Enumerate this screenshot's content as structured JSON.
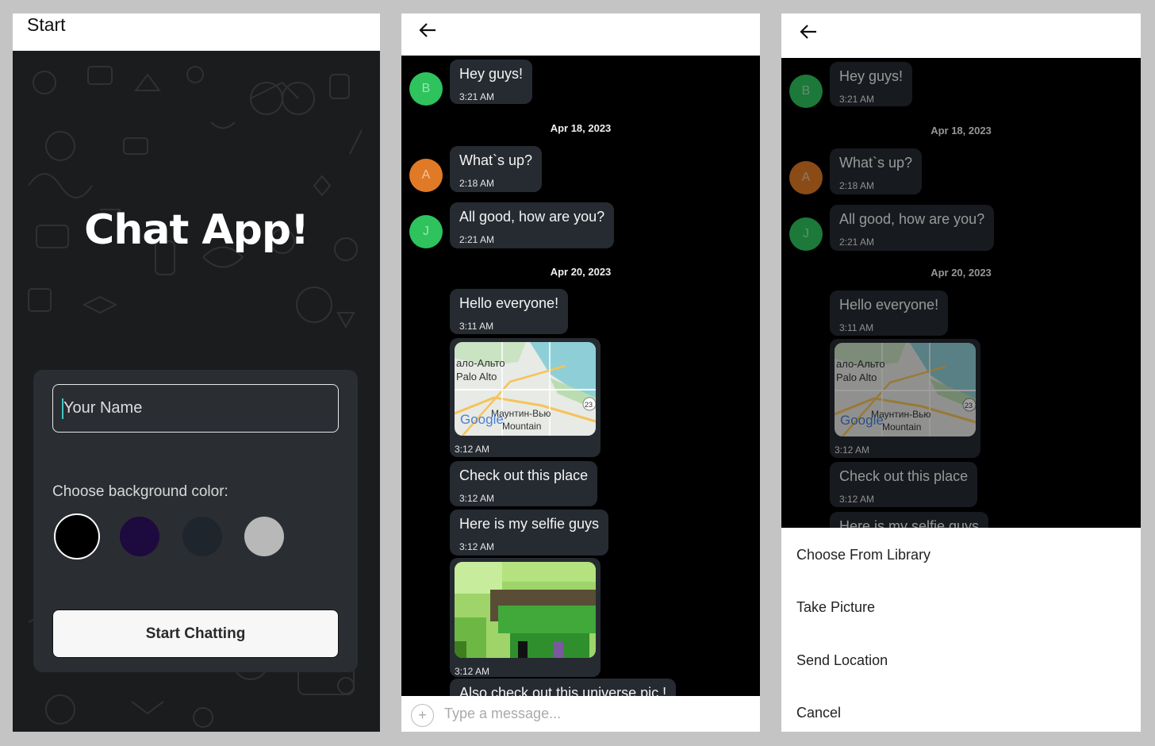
{
  "start_screen": {
    "header_title": "Start",
    "app_title": "Chat App!",
    "name_placeholder": "Your Name",
    "bg_label": "Choose background color:",
    "colors": [
      "#000000",
      "#1d0a3e",
      "#1f252d",
      "#b8b8b8"
    ],
    "selected_color": "#000000",
    "start_button": "Start Chatting"
  },
  "chat": {
    "messages": [
      {
        "avatar": "B",
        "avatar_color": "#2ec35d",
        "text": "Hey guys!",
        "time": "3:21 AM"
      },
      {
        "date": "Apr 18, 2023"
      },
      {
        "avatar": "A",
        "avatar_color": "#e07a26",
        "text": "What`s up?",
        "time": "2:18 AM"
      },
      {
        "avatar": "J",
        "avatar_color": "#2ec35d",
        "text": "All good, how are you?",
        "time": "2:21 AM"
      },
      {
        "date": "Apr 20, 2023"
      },
      {
        "text": "Hello everyone!",
        "time": "3:11 AM"
      },
      {
        "media": "map",
        "map_labels": [
          "ало-Альто",
          "Palo Alto",
          "Маунтин-Вью",
          "Mountain",
          "Google",
          "23"
        ],
        "time": "3:12 AM"
      },
      {
        "text": "Check out this place",
        "time": "3:12 AM"
      },
      {
        "text": "Here is my selfie guys",
        "time": "3:12 AM"
      },
      {
        "media": "selfie",
        "time": "3:12 AM"
      },
      {
        "text": "Also check out this universe pic !"
      }
    ],
    "composer_placeholder": "Type a message..."
  },
  "action_sheet": {
    "items": [
      "Choose From Library",
      "Take Picture",
      "Send Location",
      "Cancel"
    ]
  }
}
